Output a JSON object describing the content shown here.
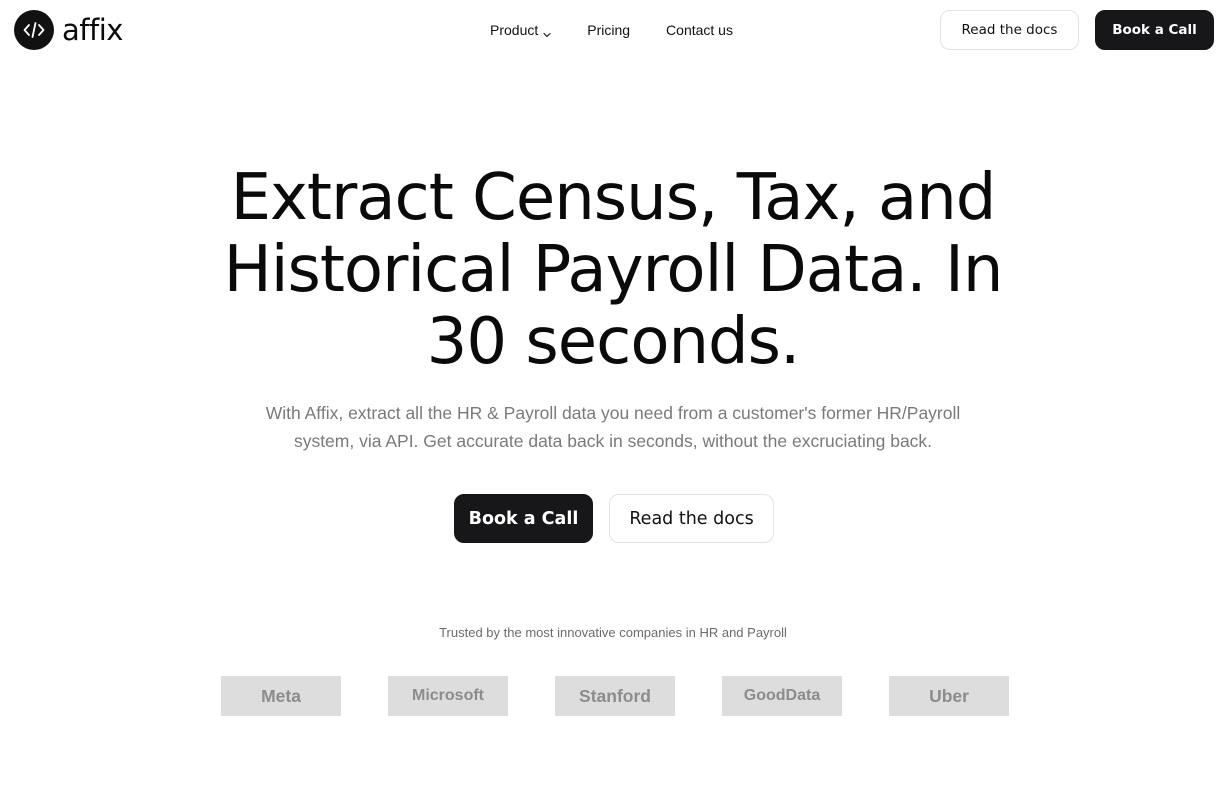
{
  "brand": {
    "name": "affix",
    "icon": "code-icon"
  },
  "nav": {
    "items": [
      {
        "label": "Product",
        "has_dropdown": true
      },
      {
        "label": "Pricing"
      },
      {
        "label": "Contact us"
      }
    ]
  },
  "header_actions": {
    "docs_label": "Read the docs",
    "call_label": "Book a Call"
  },
  "hero": {
    "title_line1": "Extract Census, Tax, and",
    "title_line2": "Historical Payroll Data. In",
    "title_line3": "30 seconds.",
    "subtitle_line1": "With Affix, extract all the HR & Payroll data you need from a customer's former HR/Payroll",
    "subtitle_line2": "system, via API. Get accurate data back in seconds, without the excruciating back.",
    "primary_cta": "Book a Call",
    "secondary_cta": "Read the docs"
  },
  "trusted": {
    "text": "Trusted by the most innovative companies in HR and Payroll",
    "logos": [
      "Meta",
      "Microsoft",
      "Stanford",
      "GoodData",
      "Uber"
    ]
  },
  "colors": {
    "primary_dark": "#17171a",
    "text_muted": "#7a7a7a",
    "logo_placeholder_bg": "#dddddd",
    "logo_placeholder_text": "#8c8c8c"
  }
}
